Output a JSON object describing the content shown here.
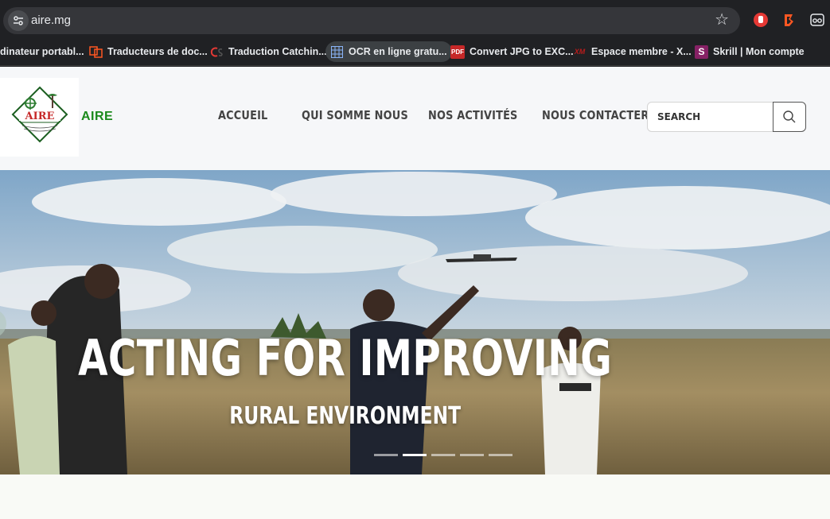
{
  "browser": {
    "url": "aire.mg",
    "bookmarks": [
      {
        "label": "dinateur portabl...",
        "icon": "none"
      },
      {
        "label": "Traducteurs de doc...",
        "icon": "translate-icon"
      },
      {
        "label": "Traduction Catchin...",
        "icon": "cs-icon"
      },
      {
        "label": "OCR en ligne gratu...",
        "icon": "grid-icon"
      },
      {
        "label": "Convert JPG to EXC...",
        "icon": "pdf-icon",
        "icon_text": "PDF"
      },
      {
        "label": "Espace membre - X...",
        "icon": "xm-icon",
        "icon_text": "XM"
      },
      {
        "label": "Skrill | Mon compte",
        "icon": "skrill-icon",
        "icon_text": "S"
      }
    ]
  },
  "site": {
    "brand": "AIRE",
    "logo_text": "AIRE",
    "nav": [
      "ACCUEIL",
      "QUI SOMME NOUS",
      "NOS ACTIVITÉS",
      "NOUS CONTACTER"
    ],
    "search": {
      "placeholder": "SEARCH"
    },
    "hero": {
      "title": "ACTING FOR IMPROVING",
      "subtitle": "RURAL ENVIRONMENT",
      "slide_count": 5,
      "active_slide": 2
    }
  },
  "colors": {
    "brand_green": "#1b8a1b",
    "chrome_bg": "#202124",
    "omnibox_bg": "#35363a"
  }
}
